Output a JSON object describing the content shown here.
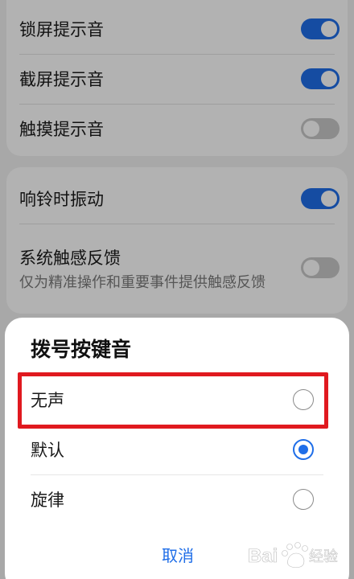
{
  "settings_top": {
    "items": [
      {
        "label": "锁屏提示音",
        "on": true
      },
      {
        "label": "截屏提示音",
        "on": true
      },
      {
        "label": "触摸提示音",
        "on": false
      }
    ]
  },
  "settings_mid": {
    "items": [
      {
        "label": "响铃时振动",
        "on": true
      },
      {
        "label": "系统触感反馈",
        "sub": "仅为精准操作和重要事件提供触感反馈",
        "on": false
      }
    ]
  },
  "dialog": {
    "title": "拨号按键音",
    "options": [
      {
        "label": "无声",
        "selected": false
      },
      {
        "label": "默认",
        "selected": true
      },
      {
        "label": "旋律",
        "selected": false
      }
    ],
    "cancel_label": "取消"
  },
  "colors": {
    "accent": "#1f6ee8",
    "highlight": "#e0191f"
  },
  "watermark": {
    "logo": "Bai du baidu-paw-logo 经验"
  }
}
